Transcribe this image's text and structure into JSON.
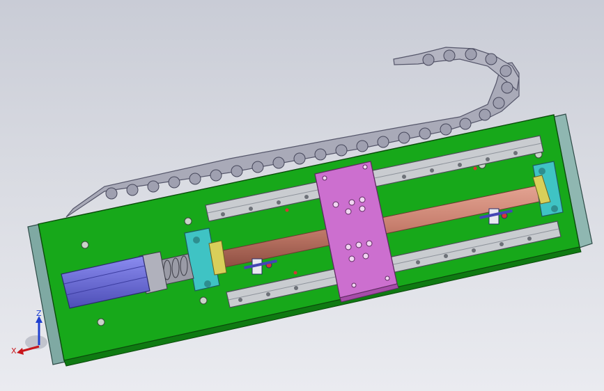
{
  "viewport": {
    "background_top": "#c9ccd6",
    "background_bottom": "#eaebf0"
  },
  "model": {
    "base_plate_color": "#17a81a",
    "end_plate_color": "#8fb7b1",
    "rail_color": "#c9ccd0",
    "carriage_color": "#cc6fcf",
    "screw_color": "#c77f6e",
    "bearing_block_color": "#3fc3c4",
    "motor_color": "#6e6fd8",
    "cable_chain_color": "#a9aab8"
  },
  "triad": {
    "z_label": "Z",
    "x_label": "X",
    "z_color": "#1f3fd0",
    "x_color": "#c8161c"
  }
}
